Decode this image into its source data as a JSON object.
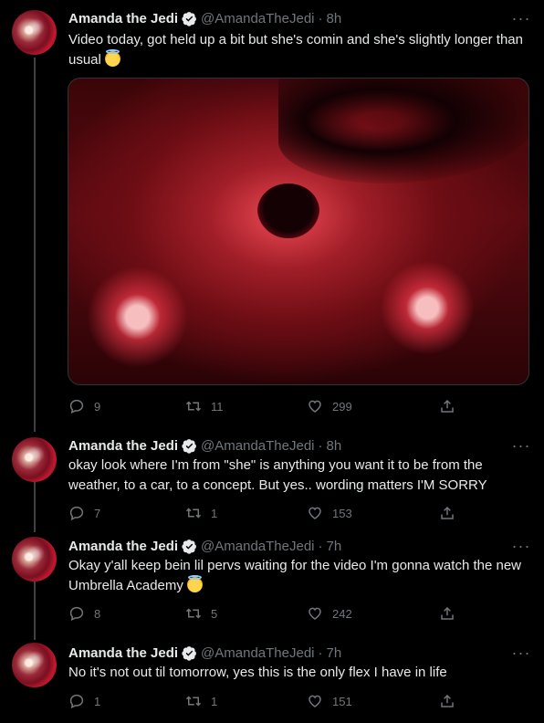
{
  "profile": {
    "name": "Amanda the Jedi",
    "handle": "@AmandaTheJedi",
    "separator": "·"
  },
  "more_label": "···",
  "tweets": [
    {
      "time": "8h",
      "text": "Video today, got held up a bit but she's comin and she's slightly longer than usual",
      "emoji": "smiling-face-with-halo",
      "has_media": true,
      "replies": "9",
      "retweets": "11",
      "likes": "299"
    },
    {
      "time": "8h",
      "text": "okay look where I'm from \"she\" is anything you want it to be from the weather, to a car, to a concept. But yes.. wording matters I'M SORRY",
      "has_media": false,
      "replies": "7",
      "retweets": "1",
      "likes": "153"
    },
    {
      "time": "7h",
      "text": "Okay y'all keep bein lil pervs waiting for the video I'm gonna watch the new Umbrella Academy",
      "emoji": "smiling-face-with-halo",
      "has_media": false,
      "replies": "8",
      "retweets": "5",
      "likes": "242"
    },
    {
      "time": "7h",
      "text": "No it's not out til tomorrow, yes this is the only flex I have in life",
      "has_media": false,
      "replies": "1",
      "retweets": "1",
      "likes": "151"
    }
  ],
  "colors": {
    "background": "#000000",
    "text": "#e7e9ea",
    "muted": "#71767b",
    "thread_line": "#3e4144"
  }
}
